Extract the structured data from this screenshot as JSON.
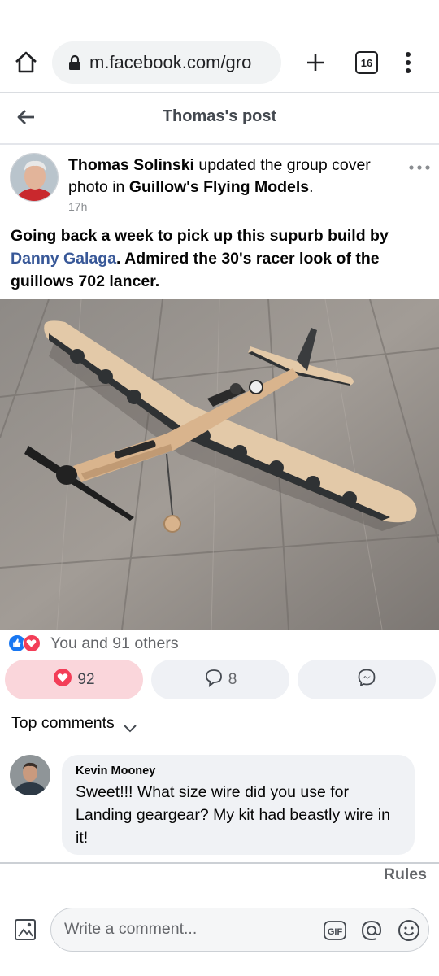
{
  "browser": {
    "url": "m.facebook.com/gro",
    "tab_count": "16",
    "icons": [
      "home-icon",
      "lock-icon",
      "plus-icon",
      "tabs-icon",
      "more-vertical-icon"
    ]
  },
  "header": {
    "title": "Thomas's post",
    "back_icon": "arrow-left-icon"
  },
  "post": {
    "author": "Thomas Solinski",
    "action_prefix": " updated the group cover photo in ",
    "group": "Guillow's Flying Models",
    "action_suffix": ".",
    "time": "17h",
    "body_before": "Going back a week to pick up this supurb build by ",
    "mention": "Danny Galaga",
    "body_after": ".  Admired the 30's racer look of the guillows 702 lancer.",
    "photo_description": "balsa model airplane on wooden floor"
  },
  "reactions": {
    "summary": "You and 91 others",
    "types": [
      "like",
      "love"
    ]
  },
  "actions": {
    "love_count": "92",
    "comment_count": "8"
  },
  "comments_section": {
    "heading": "Top comments",
    "items": [
      {
        "author": "Kevin Mooney",
        "text": "Sweet!!! What size wire did you use for Landing geargear?  My kit had beastly wire in it!"
      }
    ]
  },
  "rules_link": "Rules",
  "composer": {
    "placeholder": "Write a comment..."
  },
  "colors": {
    "facebook_blue": "#1877f2",
    "love_red": "#f33e58",
    "mention_blue": "#385898",
    "gray_text": "#65676b"
  }
}
